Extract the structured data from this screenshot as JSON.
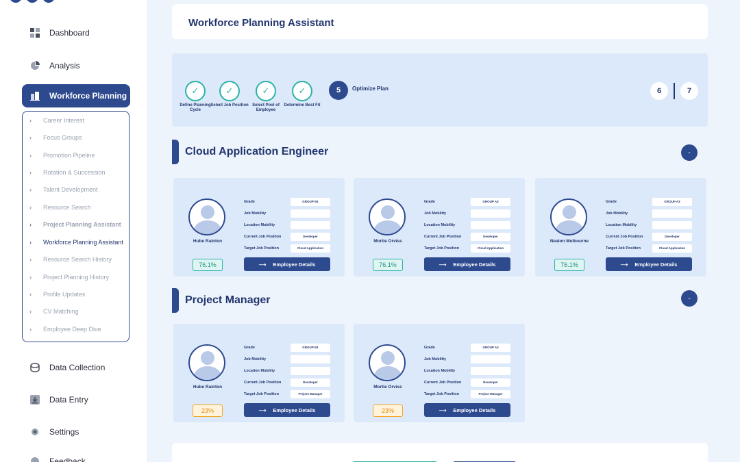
{
  "sidebar": {
    "nav": [
      {
        "label": "Dashboard",
        "icon": "dashboard-icon"
      },
      {
        "label": "Analysis",
        "icon": "pie-chart-icon"
      },
      {
        "label": "Workforce Planning",
        "icon": "building-icon"
      },
      {
        "label": "Data Collection",
        "icon": "database-icon"
      },
      {
        "label": "Data Entry",
        "icon": "download-icon"
      },
      {
        "label": "Settings",
        "icon": "gear-icon"
      },
      {
        "label": "Feedback",
        "icon": "feedback-icon"
      }
    ],
    "submenu": [
      {
        "label": "Career Interest"
      },
      {
        "label": "Focus Groups"
      },
      {
        "label": "Promotion Pipeline"
      },
      {
        "label": "Rotation & Succession"
      },
      {
        "label": "Talent Development"
      },
      {
        "label": "Resource Search"
      },
      {
        "label": "Project Planning Assistant"
      },
      {
        "label": "Workforce Planning Assistant"
      },
      {
        "label": "Resource Search History"
      },
      {
        "label": "Project Planning History"
      },
      {
        "label": "Profile Updates"
      },
      {
        "label": "CV Matching"
      },
      {
        "label": "Employee Deep Dive"
      }
    ]
  },
  "header": {
    "title": "Workforce Planning Assistant"
  },
  "steps": {
    "completed": [
      {
        "label": "Define Planning Cycle"
      },
      {
        "label": "Select Job Position"
      },
      {
        "label": "Select Pool of Employee"
      },
      {
        "label": "Determine Best Fit"
      }
    ],
    "active": {
      "number": "5",
      "label": "Optimize Plan"
    },
    "pages": [
      "6",
      "7"
    ]
  },
  "sections": [
    {
      "title": "Cloud Application Engineer",
      "collapse_label": "-",
      "cards": [
        {
          "name": "Hube Rainton",
          "grade": "GROUP B1",
          "job_mobility": "",
          "location_mobility": "",
          "current_position": "Developer",
          "target_position": "Cloud Application",
          "score": "76.1%",
          "button": "Employee Details"
        },
        {
          "name": "Mortie Orviss",
          "grade": "GROUP A3",
          "job_mobility": "",
          "location_mobility": "",
          "current_position": "Developer",
          "target_position": "Cloud Application",
          "score": "76.1%",
          "button": "Employee Details"
        },
        {
          "name": "Nealon Melbourne",
          "grade": "GROUP A3",
          "job_mobility": "",
          "location_mobility": "",
          "current_position": "Developer",
          "target_position": "Cloud Application",
          "score": "76.1%",
          "button": "Employee Details"
        }
      ]
    },
    {
      "title": "Project Manager",
      "collapse_label": "-",
      "cards": [
        {
          "name": "Hube Rainton",
          "grade": "GROUP B1",
          "job_mobility": "",
          "location_mobility": "",
          "current_position": "Developer",
          "target_position": "Project Manager",
          "score": "23%",
          "button": "Employee Details"
        },
        {
          "name": "Mortie Orviss",
          "grade": "GROUP A3",
          "job_mobility": "",
          "location_mobility": "",
          "current_position": "Developer",
          "target_position": "Project Manager",
          "score": "23%",
          "button": "Employee Details"
        }
      ]
    }
  ],
  "field_labels": {
    "grade": "Grade",
    "job_mobility": "Job Mobility",
    "location_mobility": "Location Mobility",
    "current_position": "Current Job Position",
    "target_position": "Target Job Position"
  },
  "colors": {
    "primary": "#2e4a8f",
    "teal": "#2bb3a6",
    "orange": "#f5a623",
    "panel": "#dce9fa"
  }
}
